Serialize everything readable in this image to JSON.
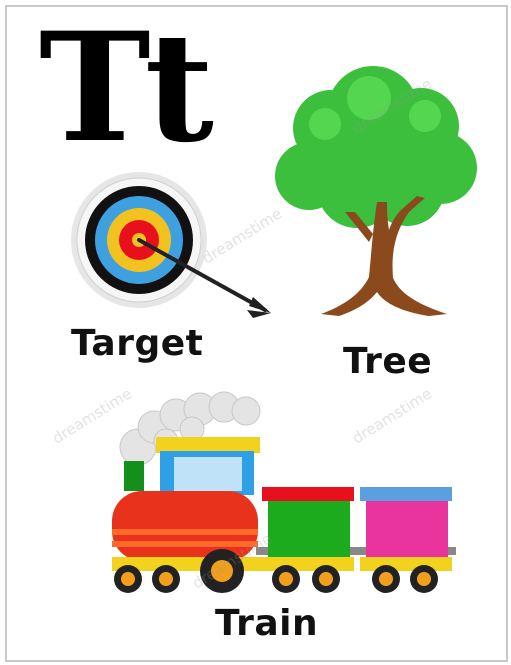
{
  "letter": "Tt",
  "words": {
    "target": "Target",
    "tree": "Tree",
    "train": "Train"
  },
  "icons": {
    "target": "target-with-arrow-icon",
    "tree": "tree-icon",
    "train": "toy-train-icon"
  },
  "colors": {
    "letter": "#000000",
    "tree_leaves": "#3cbf3c",
    "tree_trunk": "#8b4a1c",
    "train_engine": "#e8321c",
    "car_green": "#1cab1c",
    "car_pink": "#e8349c",
    "roof_red": "#e8101c",
    "roof_blue": "#5aa0e0"
  },
  "watermark": "dreamstime"
}
